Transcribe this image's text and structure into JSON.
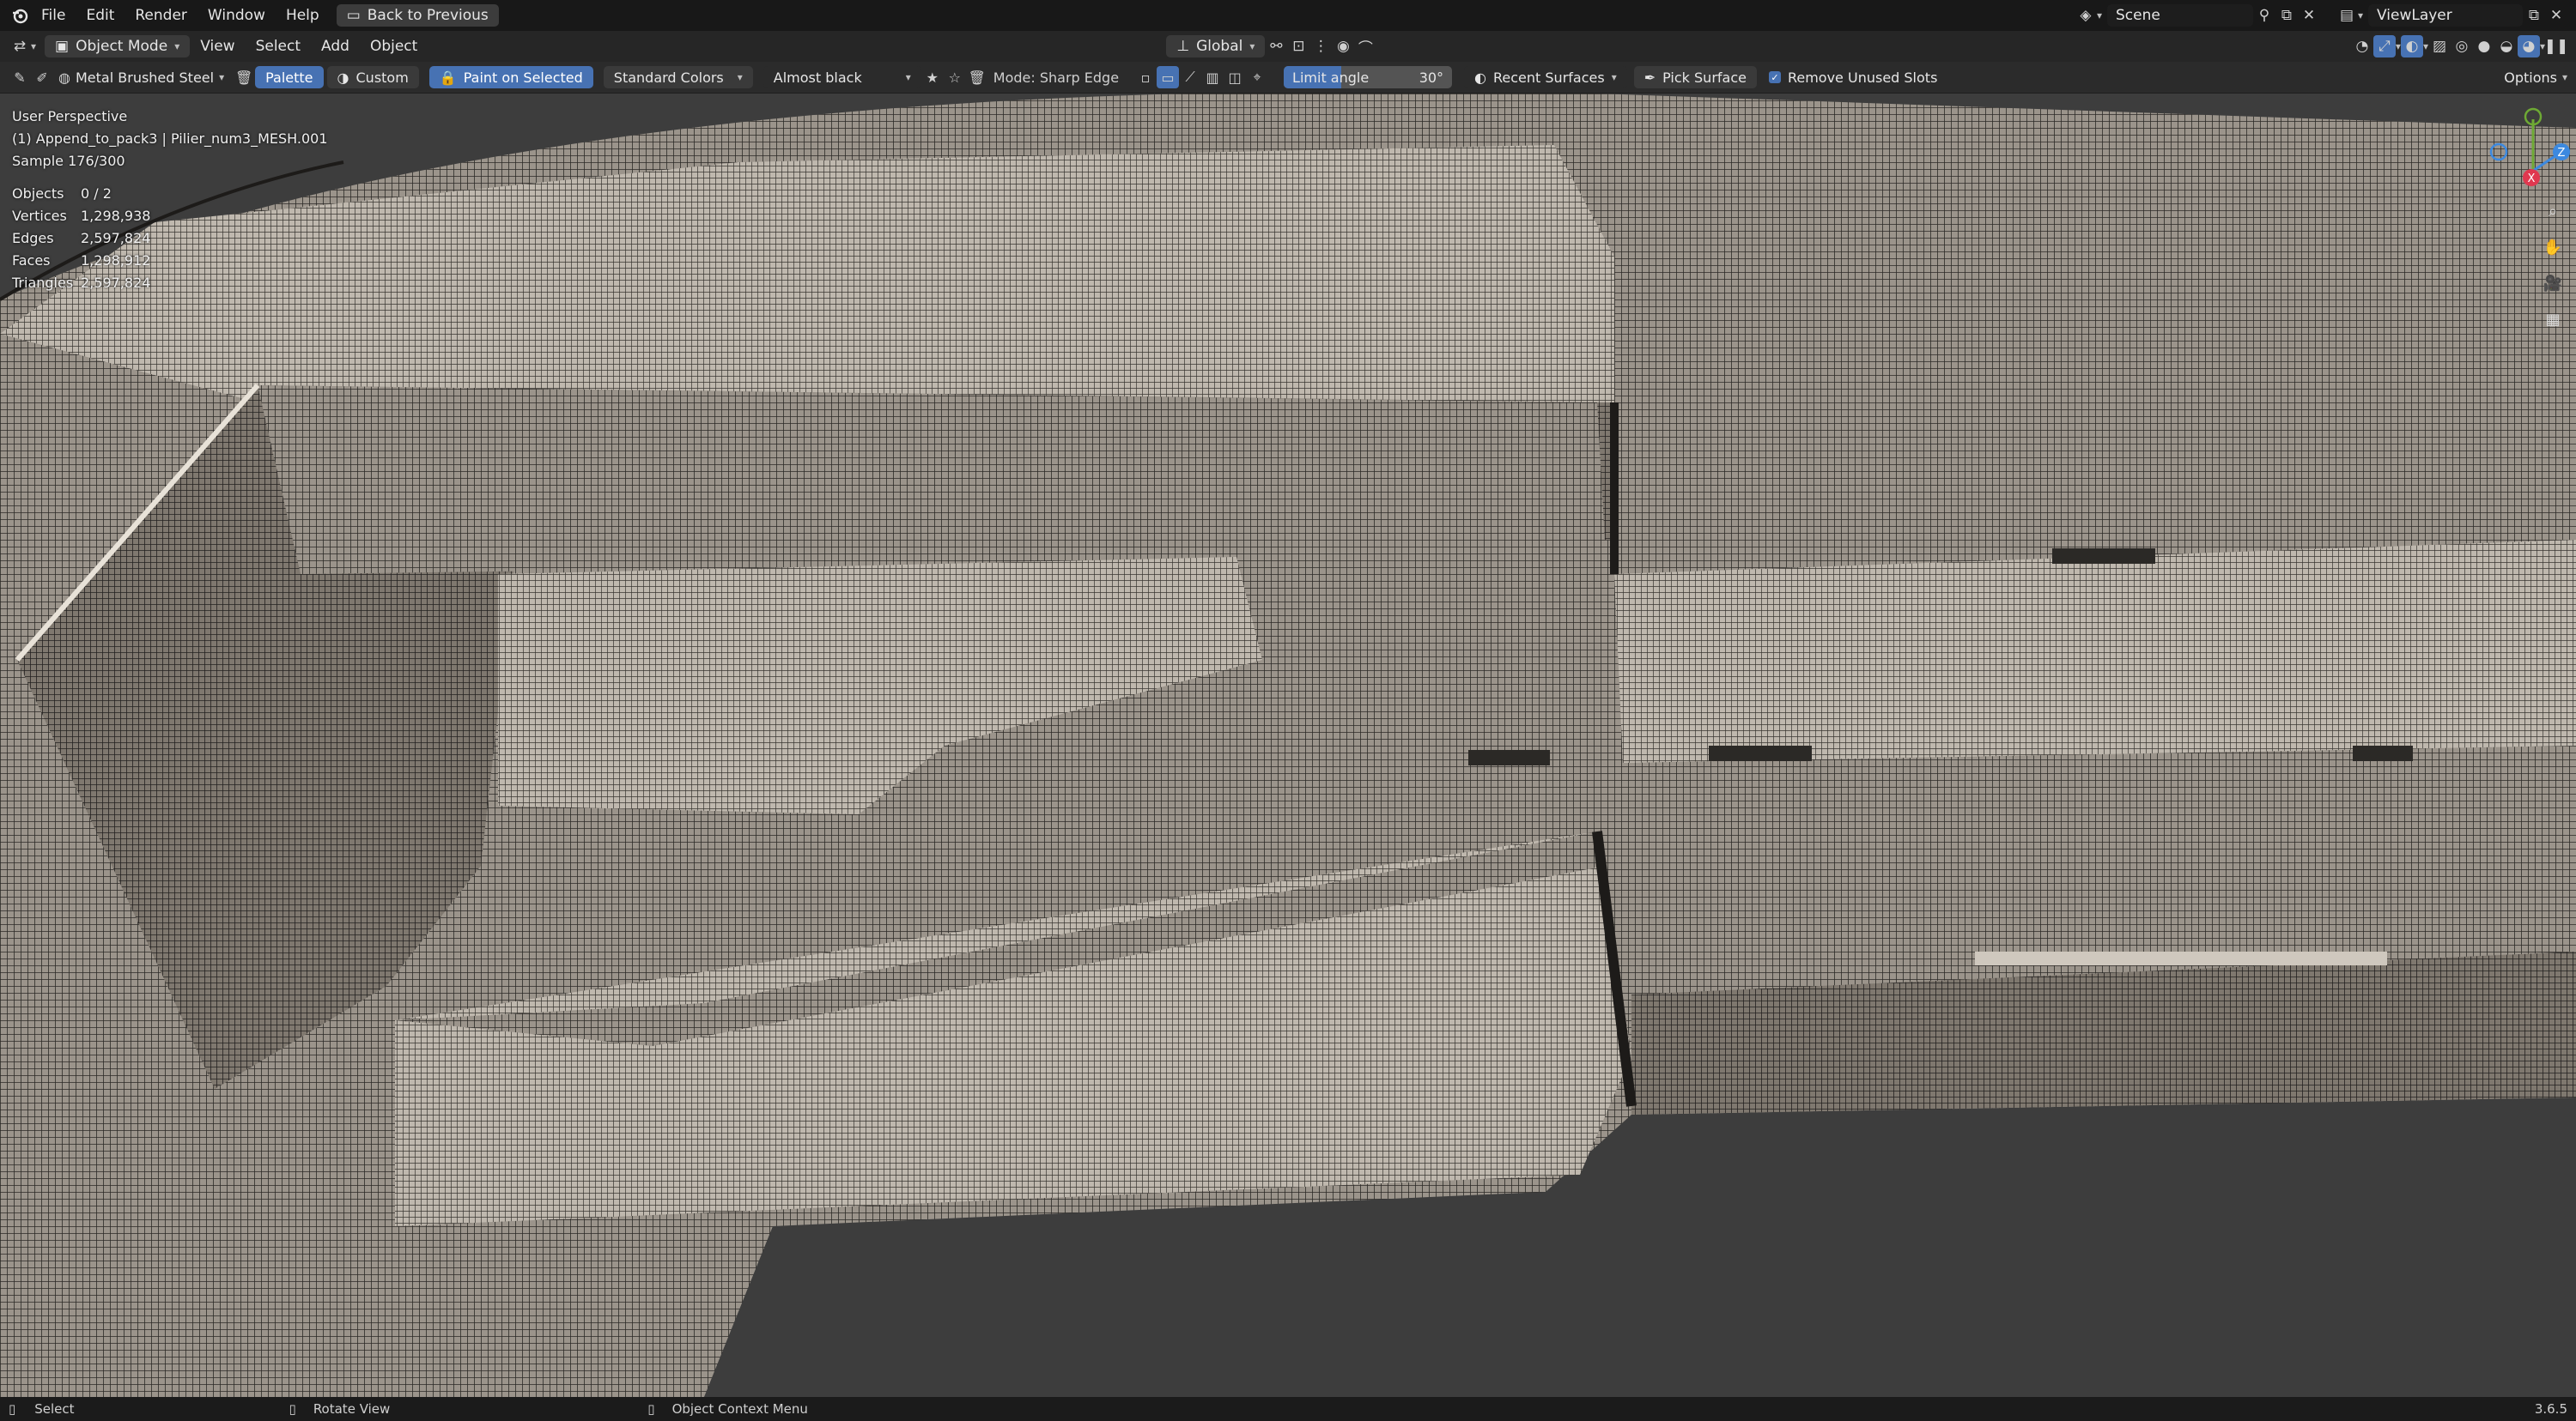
{
  "topbar": {
    "menus": [
      "File",
      "Edit",
      "Render",
      "Window",
      "Help"
    ],
    "back_button": "Back to Previous",
    "scene": "Scene",
    "view_layer": "ViewLayer"
  },
  "header": {
    "mode": "Object Mode",
    "menus": [
      "View",
      "Select",
      "Add",
      "Object"
    ],
    "transform_orientation": "Global"
  },
  "tool_header": {
    "material": "Metal Brushed Steel",
    "palette": "Palette",
    "custom": "Custom",
    "paint_on_selected": "Paint on Selected",
    "color_set": "Standard Colors",
    "color_name": "Almost black",
    "mode_label": "Mode: Sharp Edge",
    "limit_angle_label": "Limit angle",
    "limit_angle_value": "30°",
    "limit_angle_fraction": 0.34,
    "recent_surfaces": "Recent Surfaces",
    "pick_surface": "Pick Surface",
    "remove_unused_slots": "Remove Unused Slots",
    "remove_unused_checked": true,
    "options": "Options"
  },
  "viewport": {
    "perspective": "User Perspective",
    "object_info": "(1) Append_to_pack3 | Pilier_num3_MESH.001",
    "sample": "Sample 176/300",
    "stats": [
      {
        "label": "Objects",
        "value": "0 / 2"
      },
      {
        "label": "Vertices",
        "value": "1,298,938"
      },
      {
        "label": "Edges",
        "value": "2,597,824"
      },
      {
        "label": "Faces",
        "value": "1,298,912"
      },
      {
        "label": "Triangles",
        "value": "2,597,824"
      }
    ],
    "gizmo": {
      "x": "X",
      "z": "Z",
      "x_color": "#e0384f",
      "y_color": "#6ea934",
      "z_color": "#3c89e0"
    }
  },
  "statusbar": {
    "select": "Select",
    "rotate": "Rotate View",
    "context": "Object Context Menu",
    "version": "3.6.5"
  },
  "colors": {
    "accent": "#4772b3",
    "bg": "#3d3d3d"
  }
}
